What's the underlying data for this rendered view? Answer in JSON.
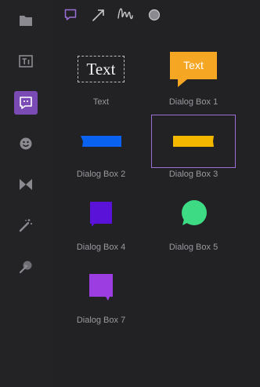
{
  "sidebar": {
    "items": [
      {
        "name": "media",
        "icon": "folder-icon"
      },
      {
        "name": "titles",
        "icon": "text-tool-icon"
      },
      {
        "name": "elements",
        "icon": "speech-bubble-icon",
        "active": true
      },
      {
        "name": "stickers",
        "icon": "smiley-icon"
      },
      {
        "name": "transitions",
        "icon": "bowtie-icon"
      },
      {
        "name": "effects",
        "icon": "magic-wand-icon"
      },
      {
        "name": "cursor",
        "icon": "cursor-click-icon"
      }
    ]
  },
  "toolbar": {
    "items": [
      {
        "name": "dialog",
        "icon": "speech-bubble-icon",
        "active": true
      },
      {
        "name": "arrow",
        "icon": "arrow-icon"
      },
      {
        "name": "wave",
        "icon": "squiggle-icon"
      },
      {
        "name": "shape",
        "icon": "circle-icon"
      }
    ]
  },
  "library": {
    "items": [
      {
        "preview": "Text",
        "label": "Text"
      },
      {
        "preview": "Text",
        "label": "Dialog Box 1"
      },
      {
        "label": "Dialog Box 2"
      },
      {
        "label": "Dialog Box 3",
        "selected": true
      },
      {
        "label": "Dialog Box 4"
      },
      {
        "label": "Dialog Box 5"
      },
      {
        "label": "Dialog Box 7"
      }
    ]
  },
  "colors": {
    "accent": "#7a4bb5",
    "selection": "#9b6fd6",
    "dialog1": "#f5a623",
    "dialog2": "#0a63f0",
    "dialog3": "#f5b800",
    "dialog4": "#5a12d8",
    "dialog5": "#3ddc84",
    "dialog7": "#9b3de0"
  }
}
